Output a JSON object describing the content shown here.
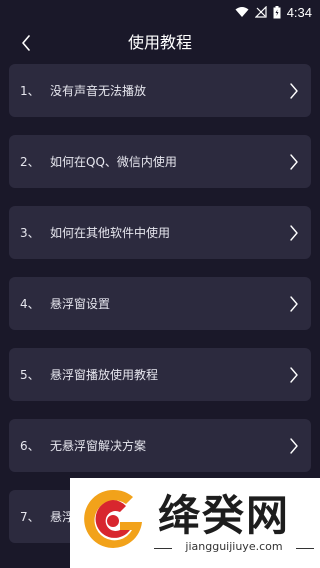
{
  "status_bar": {
    "time": "4:34",
    "icons": [
      "wifi-icon",
      "no-signal-icon",
      "battery-icon"
    ]
  },
  "header": {
    "title": "使用教程",
    "back_icon": "chevron-left-icon"
  },
  "items": [
    {
      "num": "1、",
      "label": "没有声音无法播放"
    },
    {
      "num": "2、",
      "label": "如何在QQ、微信内使用"
    },
    {
      "num": "3、",
      "label": "如何在其他软件中使用"
    },
    {
      "num": "4、",
      "label": "悬浮窗设置"
    },
    {
      "num": "5、",
      "label": "悬浮窗播放使用教程"
    },
    {
      "num": "6、",
      "label": "无悬浮窗解决方案"
    },
    {
      "num": "7、",
      "label": "悬浮"
    }
  ],
  "watermark": {
    "name": "绛癸网",
    "url": "jiangguijiuye.com"
  },
  "colors": {
    "background": "#1a1829",
    "card": "#2c2a3e",
    "text": "#ffffff"
  }
}
